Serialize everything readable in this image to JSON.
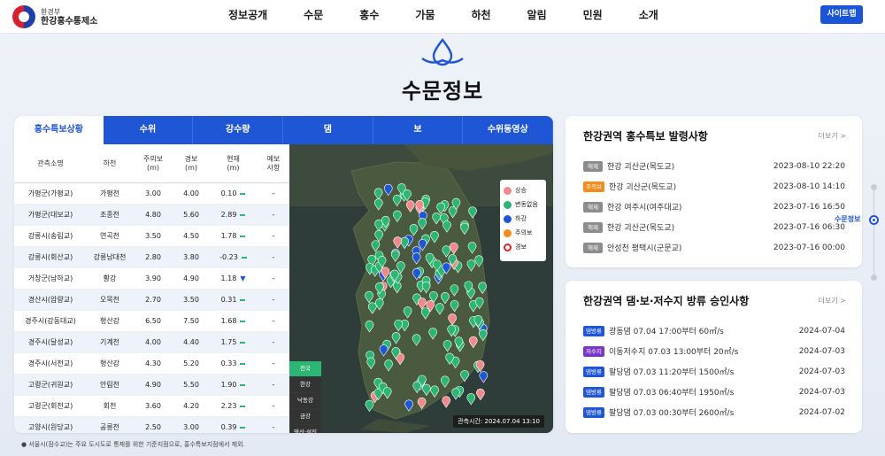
{
  "header": {
    "ministry": "환경부",
    "org": "한강홍수통제소",
    "nav": [
      "정보공개",
      "수문",
      "홍수",
      "가뭄",
      "하천",
      "알림",
      "민원",
      "소개"
    ],
    "sitemap": "사이트맵"
  },
  "page_title": "수문정보",
  "tabs": [
    "홍수특보상황",
    "수위",
    "강수량",
    "댐",
    "보",
    "수위동영상"
  ],
  "table": {
    "headers": [
      "관측소명",
      "하천",
      "주의보\n(m)",
      "경보\n(m)",
      "현재\n(m)",
      "예보\n사항"
    ],
    "rows": [
      {
        "station": "가평군(가평교)",
        "river": "가평천",
        "watch": "3.00",
        "warn": "4.00",
        "now": "0.10",
        "trend": "flat",
        "fc": "-"
      },
      {
        "station": "가평군(대보교)",
        "river": "조종천",
        "watch": "4.80",
        "warn": "5.60",
        "now": "2.89",
        "trend": "flat",
        "fc": "-"
      },
      {
        "station": "강릉시(송림교)",
        "river": "연곡천",
        "watch": "3.50",
        "warn": "4.50",
        "now": "1.78",
        "trend": "flat",
        "fc": "-"
      },
      {
        "station": "강릉시(회산교)",
        "river": "강릉남대천",
        "watch": "2.80",
        "warn": "3.80",
        "now": "-0.23",
        "trend": "flat",
        "fc": "-"
      },
      {
        "station": "거창군(남하교)",
        "river": "황강",
        "watch": "3.90",
        "warn": "4.90",
        "now": "1.18",
        "trend": "down",
        "fc": "-"
      },
      {
        "station": "경산시(압량교)",
        "river": "오목천",
        "watch": "2.70",
        "warn": "3.50",
        "now": "0.31",
        "trend": "flat",
        "fc": "-"
      },
      {
        "station": "경주시(강동대교)",
        "river": "형산강",
        "watch": "6.50",
        "warn": "7.50",
        "now": "1.68",
        "trend": "flat",
        "fc": "-"
      },
      {
        "station": "경주시(달성교)",
        "river": "기계천",
        "watch": "4.00",
        "warn": "4.40",
        "now": "1.75",
        "trend": "flat",
        "fc": "-"
      },
      {
        "station": "경주시(서천교)",
        "river": "형산강",
        "watch": "4.30",
        "warn": "5.20",
        "now": "0.33",
        "trend": "flat",
        "fc": "-"
      },
      {
        "station": "고령군(귀원교)",
        "river": "안림천",
        "watch": "4.90",
        "warn": "5.50",
        "now": "1.90",
        "trend": "flat",
        "fc": "-"
      },
      {
        "station": "고령군(회천교)",
        "river": "회천",
        "watch": "3.60",
        "warn": "4.20",
        "now": "2.23",
        "trend": "flat",
        "fc": "-"
      },
      {
        "station": "고양시(원당교)",
        "river": "공릉천",
        "watch": "2.50",
        "warn": "3.00",
        "now": "0.39",
        "trend": "flat",
        "fc": "-"
      }
    ]
  },
  "map": {
    "legend": [
      {
        "label": "상승",
        "color": "#f08a8a",
        "icon": "triangle-up-icon"
      },
      {
        "label": "변동없음",
        "color": "#2bb673",
        "icon": "dash-icon"
      },
      {
        "label": "하강",
        "color": "#1f56d6",
        "icon": "triangle-down-icon"
      },
      {
        "label": "주의보",
        "color": "#f28c1a",
        "icon": "exclamation-icon"
      },
      {
        "label": "경보",
        "color": "#e02424",
        "icon": "alert-icon"
      }
    ],
    "regions": [
      "전국",
      "한강",
      "낙동강",
      "금강",
      "영산·섬진"
    ],
    "observed": "관측시간: 2024.07.04 13:10"
  },
  "note": "● 서울시(잠수교)는 주요 도시도로 통제를 위한 기준지점으로, 홍수특보지점에서 제외.",
  "flood_card": {
    "title": "한강권역 홍수특보 발령사항",
    "more": "더보기 >",
    "items": [
      {
        "badge": "해제",
        "color": "#8c8c8c",
        "text": "한강 괴산군(목도교)",
        "date": "2023-08-10 22:20"
      },
      {
        "badge": "주의보",
        "color": "#f28c1a",
        "text": "한강 괴산군(목도교)",
        "date": "2023-08-10 14:10"
      },
      {
        "badge": "해제",
        "color": "#8c8c8c",
        "text": "한강 여주시(여주대교)",
        "date": "2023-07-16 16:50"
      },
      {
        "badge": "해제",
        "color": "#8c8c8c",
        "text": "한강 괴산군(목도교)",
        "date": "2023-07-16 06:30"
      },
      {
        "badge": "해제",
        "color": "#8c8c8c",
        "text": "안성천 평택시(군문교)",
        "date": "2023-07-16 00:00"
      }
    ]
  },
  "dam_card": {
    "title": "한강권역 댐·보·저수지 방류 승인사항",
    "more": "더보기 >",
    "items": [
      {
        "badge": "댐방류",
        "color": "#1f56d6",
        "text": "광동댐 07.04 17:00부터 60㎥/s",
        "date": "2024-07-04"
      },
      {
        "badge": "저수지",
        "color": "#7a35c9",
        "text": "이동저수지 07.03 13:00부터 20㎥/s",
        "date": "2024-07-03"
      },
      {
        "badge": "댐방류",
        "color": "#1f56d6",
        "text": "팔당댐 07.03 11:20부터 1500㎥/s",
        "date": "2024-07-03"
      },
      {
        "badge": "댐방류",
        "color": "#1f56d6",
        "text": "팔당댐 07.03 06:40부터 1950㎥/s",
        "date": "2024-07-03"
      },
      {
        "badge": "댐방류",
        "color": "#1f56d6",
        "text": "팔당댐 07.03 00:30부터 2600㎥/s",
        "date": "2024-07-02"
      }
    ]
  },
  "side_nav": {
    "label": "수문정보"
  }
}
